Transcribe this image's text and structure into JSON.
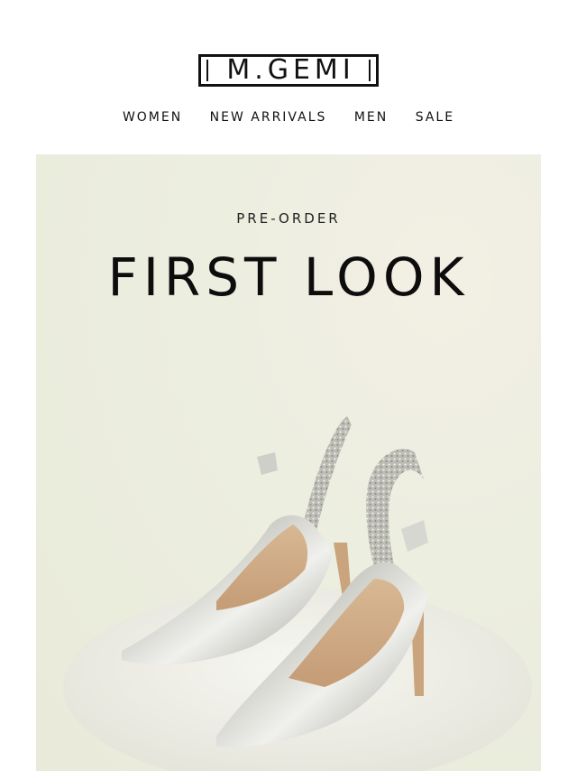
{
  "brand": {
    "logo_text": "M.GEMI"
  },
  "nav": {
    "items": [
      "WOMEN",
      "NEW ARRIVALS",
      "MEN",
      "SALE"
    ]
  },
  "hero": {
    "eyebrow": "PRE-ORDER",
    "headline": "FIRST LOOK",
    "image": "silver-slingback-pumps"
  }
}
